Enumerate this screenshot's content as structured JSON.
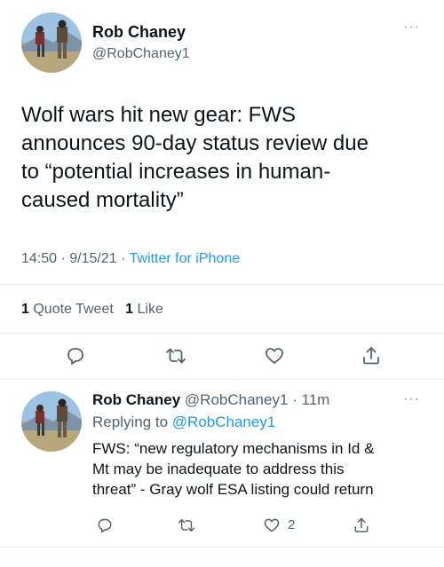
{
  "main_tweet": {
    "author_name": "Rob Chaney",
    "author_handle": "@RobChaney1",
    "more_icon": "more-dots-icon",
    "text_lines": [
      "Wolf wars hit new gear: FWS",
      "announces 90-day status review due",
      "to “potential increases in human-",
      "caused mortality”"
    ],
    "time": "14:50",
    "date": "9/15/21",
    "source": "Twitter for iPhone",
    "quote_count": "1",
    "quote_label": "Quote Tweet",
    "like_count": "1",
    "like_label": "Like",
    "actions": [
      "reply-icon",
      "retweet-icon",
      "like-icon",
      "share-icon"
    ]
  },
  "reply_tweet": {
    "author_name": "Rob Chaney",
    "author_handle": "@RobChaney1",
    "time_ago": "11m",
    "replying_prefix": "Replying to",
    "replying_to": "@RobChaney1",
    "text_lines": [
      "FWS: “new regulatory mechanisms in Id &",
      "Mt may be inadequate to address this",
      "threat” - Gray wolf ESA listing could return"
    ],
    "like_count": "2"
  }
}
